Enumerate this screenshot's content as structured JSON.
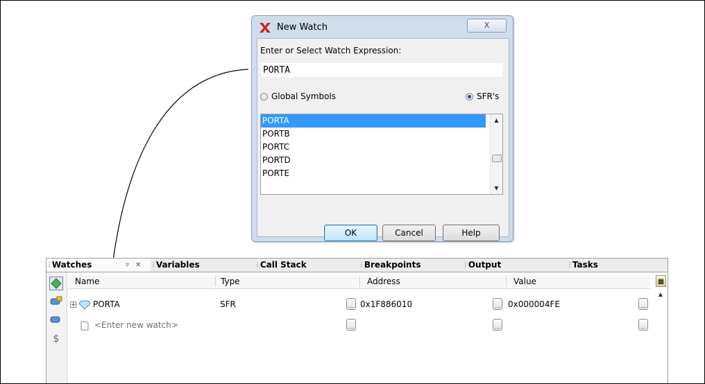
{
  "dialog": {
    "title": "New Watch",
    "close_label": "X",
    "prompt_label": "Enter or Select Watch Expression:",
    "expression_value": "PORTA",
    "radio_global_label": "Global Symbols",
    "radio_sfr_label": "SFR's",
    "selected_radio": "SFR's",
    "symbols": [
      "PORTA",
      "PORTB",
      "PORTC",
      "PORTD",
      "PORTE"
    ],
    "selected_symbol": "PORTA",
    "ok_label": "OK",
    "cancel_label": "Cancel",
    "help_label": "Help"
  },
  "tabs": [
    {
      "label": "Watches",
      "active": true
    },
    {
      "label": "Variables"
    },
    {
      "label": "Call Stack"
    },
    {
      "label": "Breakpoints"
    },
    {
      "label": "Output"
    },
    {
      "label": "Tasks"
    }
  ],
  "watches": {
    "columns": [
      "Name",
      "Type",
      "Address",
      "Value"
    ],
    "rows": [
      {
        "name": "PORTA",
        "type": "SFR",
        "address": "0x1F886010",
        "value": "0x000004FE"
      }
    ],
    "new_watch_placeholder": "<Enter new watch>"
  },
  "colors": {
    "selection": "#3399ff",
    "dialog_frame": "#cfdcec",
    "tab_bar": "#ececec"
  }
}
